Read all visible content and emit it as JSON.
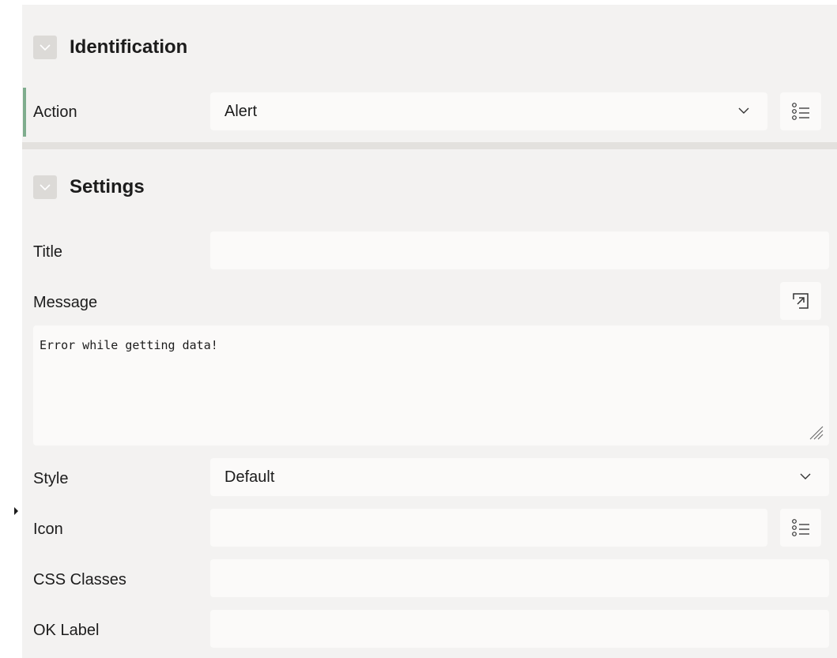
{
  "identification": {
    "title": "Identification",
    "action_label": "Action",
    "action_value": "Alert"
  },
  "settings": {
    "title": "Settings",
    "title_label": "Title",
    "title_value": "",
    "message_label": "Message",
    "message_value": "Error while getting data!",
    "style_label": "Style",
    "style_value": "Default",
    "icon_label": "Icon",
    "icon_value": "",
    "css_classes_label": "CSS Classes",
    "css_classes_value": "",
    "ok_label_label": "OK Label",
    "ok_label_value": ""
  },
  "icons": {
    "collapse": "chevron-down-icon",
    "dropdown": "chevron-down-icon",
    "list_picker": "list-picker-icon",
    "expand": "open-in-editor-icon",
    "resize": "resize-grip-icon"
  },
  "colors": {
    "panel_bg": "#f3f2f1",
    "field_bg": "#fbfaf9",
    "accent": "#7fad8e",
    "divider": "#e3e1de"
  }
}
